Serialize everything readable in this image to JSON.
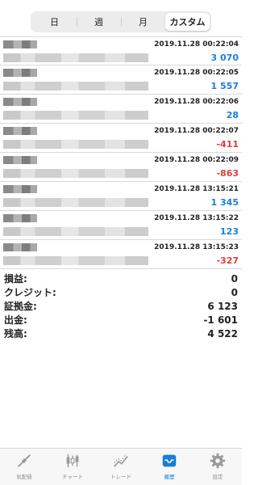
{
  "tabs": [
    {
      "label": "日",
      "active": false
    },
    {
      "label": "週",
      "active": false
    },
    {
      "label": "月",
      "active": false
    },
    {
      "label": "カスタム",
      "active": true
    }
  ],
  "trades": [
    {
      "time": "2019.11.28 00:22:04",
      "amount": "3 070",
      "sign": "pos"
    },
    {
      "time": "2019.11.28 00:22:05",
      "amount": "1 557",
      "sign": "pos"
    },
    {
      "time": "2019.11.28 00:22:06",
      "amount": "28",
      "sign": "pos"
    },
    {
      "time": "2019.11.28 00:22:07",
      "amount": "-411",
      "sign": "neg"
    },
    {
      "time": "2019.11.28 00:22:09",
      "amount": "-863",
      "sign": "neg"
    },
    {
      "time": "2019.11.28 13:15:21",
      "amount": "1 345",
      "sign": "pos"
    },
    {
      "time": "2019.11.28 13:15:22",
      "amount": "123",
      "sign": "pos"
    },
    {
      "time": "2019.11.28 13:15:23",
      "amount": "-327",
      "sign": "neg"
    }
  ],
  "summary": [
    {
      "label": "損益:",
      "value": "0"
    },
    {
      "label": "クレジット:",
      "value": "0"
    },
    {
      "label": "証拠金:",
      "value": "6 123"
    },
    {
      "label": "出金:",
      "value": "-1 601"
    },
    {
      "label": "残高:",
      "value": "4 522"
    }
  ],
  "nav": [
    {
      "label": "気配値",
      "icon": "quotes-icon",
      "active": false
    },
    {
      "label": "チャート",
      "icon": "chart-icon",
      "active": false
    },
    {
      "label": "トレード",
      "icon": "trade-icon",
      "active": false
    },
    {
      "label": "履歴",
      "icon": "history-icon",
      "active": true
    },
    {
      "label": "設定",
      "icon": "settings-icon",
      "active": false
    }
  ],
  "colors": {
    "accent": "#1a7ed6",
    "profit": "#1a7ed6",
    "loss": "#e33b3b"
  }
}
